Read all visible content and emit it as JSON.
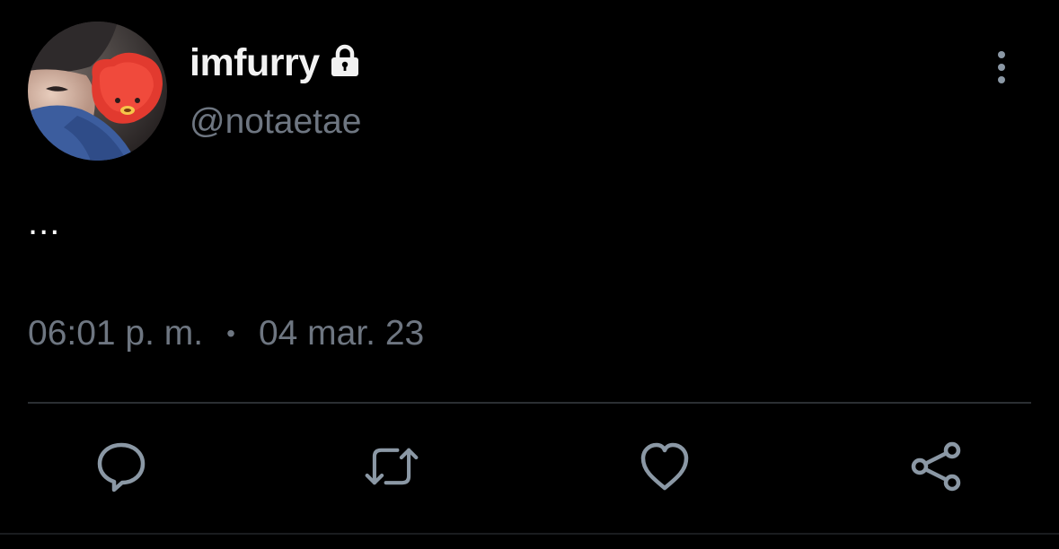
{
  "user": {
    "display_name": "imfurry",
    "handle": "@notaetae",
    "protected_icon": "lock-icon",
    "avatar_alt": "profile-avatar"
  },
  "tweet": {
    "text": "...",
    "time": "06:01 p. m.",
    "separator": "•",
    "date": "04 mar. 23"
  },
  "actions": {
    "reply_icon": "reply-icon",
    "retweet_icon": "retweet-icon",
    "like_icon": "heart-icon",
    "share_icon": "share-icon",
    "more_icon": "more-vertical-icon"
  },
  "colors": {
    "background": "#000000",
    "text_primary": "#f2f2f2",
    "text_secondary": "#6e7681",
    "divider": "#2b2f33",
    "icon": "#8b98a5"
  }
}
